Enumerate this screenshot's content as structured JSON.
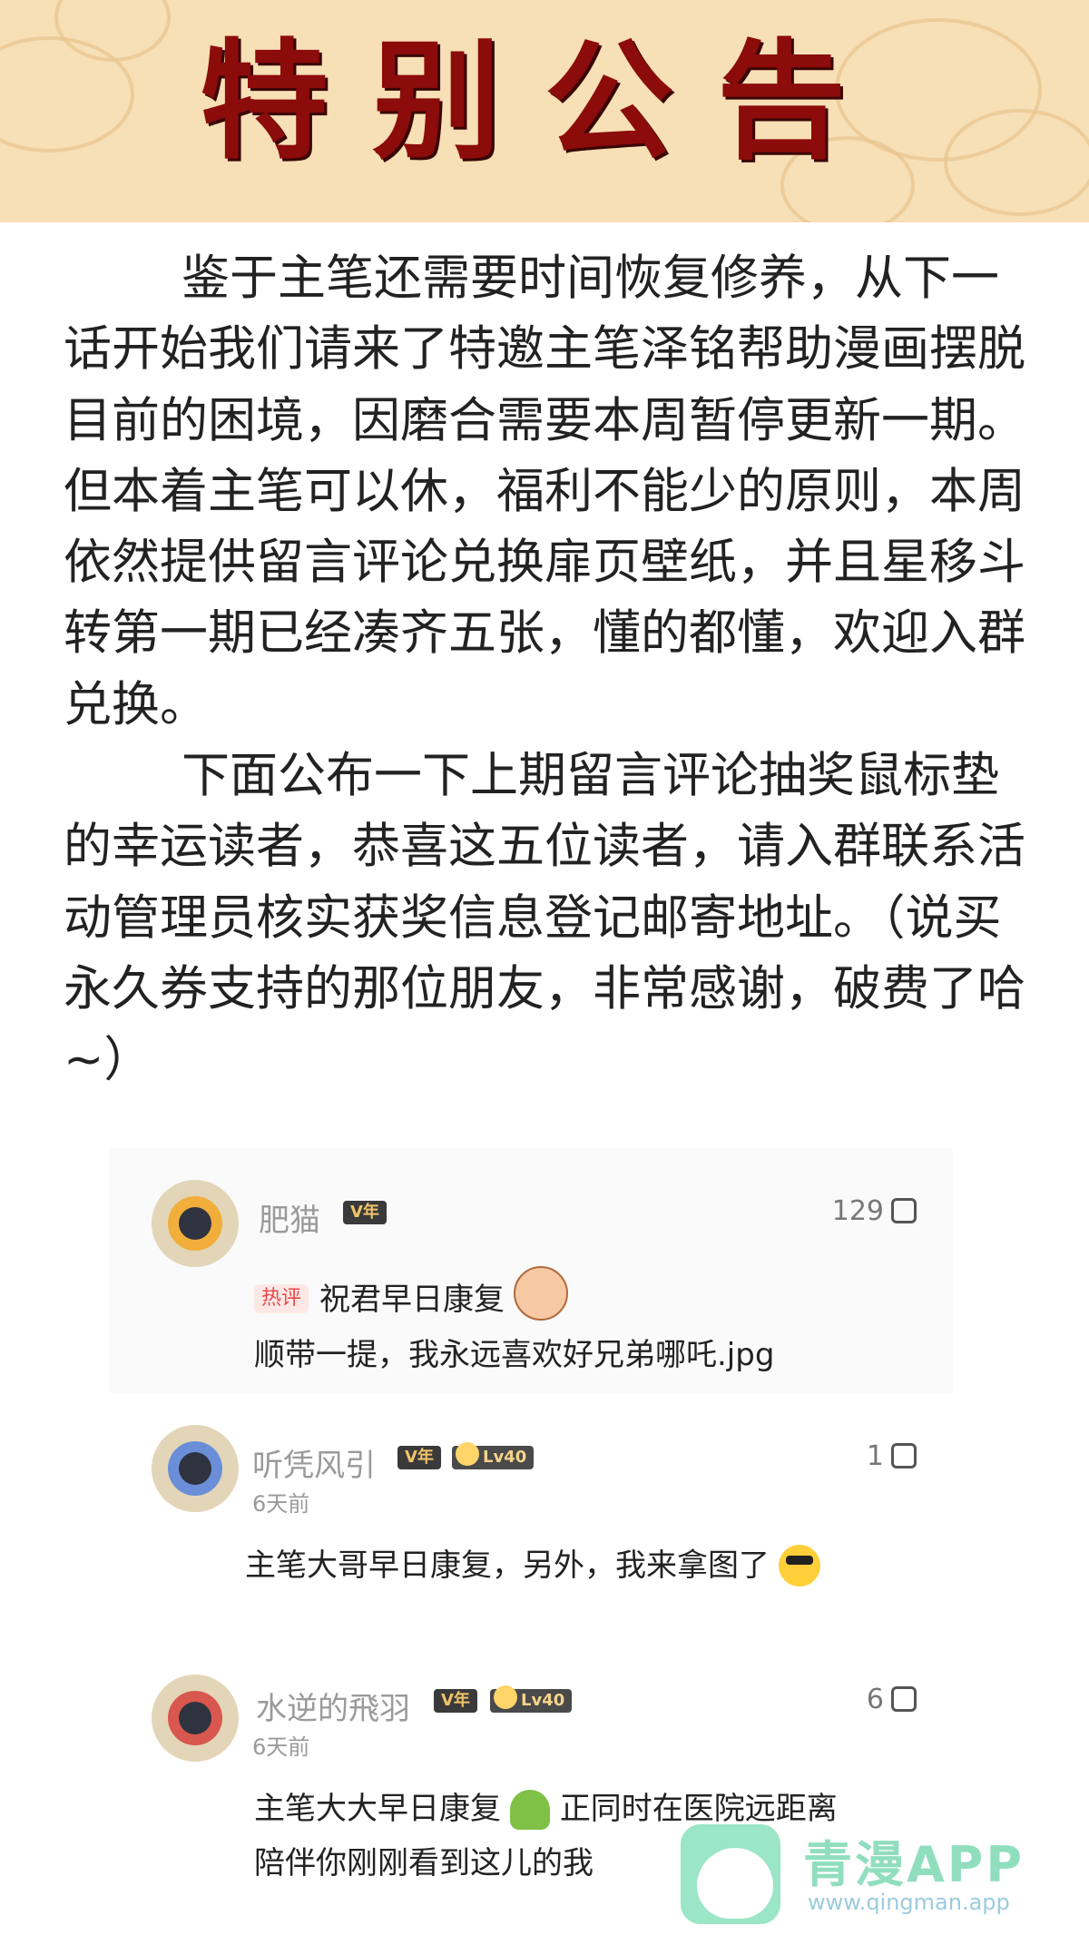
{
  "banner": {
    "title": "特别公告"
  },
  "notice": {
    "paragraphs": [
      "鉴于主笔还需要时间恢复修养，从下一话开始我们请来了特邀主笔泽铭帮助漫画摆脱目前的困境，因磨合需要本周暂停更新一期。但本着主笔可以休，福利不能少的原则，本周依然提供留言评论兑换扉页壁纸，并且星移斗转第一期已经凑齐五张，懂的都懂，欢迎入群兑换。",
      "下面公布一下上期留言评论抽奖鼠标垫的幸运读者，恭喜这五位读者，请入群联系活动管理员核实获奖信息登记邮寄地址。（说买永久券支持的那位朋友，非常感谢，破费了哈~）"
    ]
  },
  "comments": [
    {
      "username": "肥猫",
      "vip_badge": "V年",
      "likes": "129",
      "hot_tag": "热评",
      "line1": "祝君早日康复",
      "line2": "顺带一提，我永远喜欢好兄弟哪吒.jpg"
    },
    {
      "username": "听凭风引",
      "vip_badge": "V年",
      "level": "Lv40",
      "likes": "1",
      "time": "6天前",
      "text": "主笔大哥早日康复，另外，我来拿图了"
    },
    {
      "username": "水逆的飛羽",
      "vip_badge": "V年",
      "level": "Lv40",
      "likes": "6",
      "time": "6天前",
      "line1_a": "主笔大大早日康复",
      "line1_b": "正同时在医院远距离",
      "line2": "陪伴你刚刚看到这儿的我"
    }
  ],
  "watermark": {
    "name": "青漫APP",
    "url": "www.qingman.app"
  },
  "colors": {
    "banner_bg": "#f7dfb6",
    "title_red": "#8c0b0b",
    "watermark_green": "#47c994"
  }
}
